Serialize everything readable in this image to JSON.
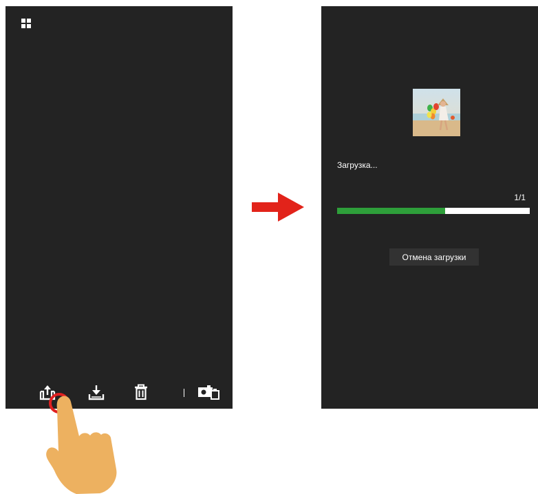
{
  "left_screen": {
    "top_icon": "grid-view-icon",
    "toolbar": {
      "icons": [
        "upload-icon",
        "download-icon",
        "trash-icon",
        "camera-switch-icon"
      ]
    }
  },
  "right_screen": {
    "status": "Загрузка...",
    "counter": "1/1",
    "progress_fraction": 0.56,
    "cancel_label": "Отмена загрузки"
  },
  "colors": {
    "screen_bg": "#232323",
    "progress_fill": "#2e9f3a",
    "arrow": "#e2231a",
    "tap_ring": "#e02020",
    "hand": "#edb160"
  }
}
